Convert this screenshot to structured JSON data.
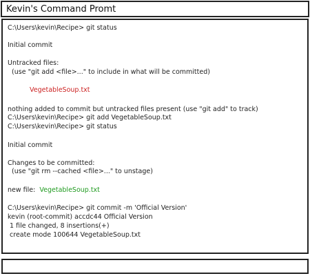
{
  "window": {
    "title": "Kevin's Command Promt"
  },
  "colors": {
    "untracked": "#cc2222",
    "staged": "#1f9a1f",
    "text": "#222222"
  },
  "terminal": {
    "l1": "C:\\Users\\kevin\\Recipe> git status",
    "l2": "Initial commit",
    "l3": "Untracked files:",
    "l4": "  (use \"git add <file>...\" to include in what will be committed)",
    "l5": "VegetableSoup.txt",
    "l6": "nothing added to commit but untracked files present (use \"git add\" to track)",
    "l7": "C:\\Users\\kevin\\Recipe> git add VegetableSoup.txt",
    "l8": "C:\\Users\\kevin\\Recipe> git status",
    "l9": "Initial commit",
    "l10": "Changes to be committed:",
    "l11": "  (use \"git rm --cached <file>...\" to unstage)",
    "l12_label": "new file:  ",
    "l12_file": "VegetableSoup.txt",
    "l13": "C:\\Users\\kevin\\Recipe> git commit -m 'Official Version'",
    "l14": "kevin (root-commit) accdc44 Official Version",
    "l15": " 1 file changed, 8 insertions(+)",
    "l16": " create mode 100644 VegetableSoup.txt"
  }
}
